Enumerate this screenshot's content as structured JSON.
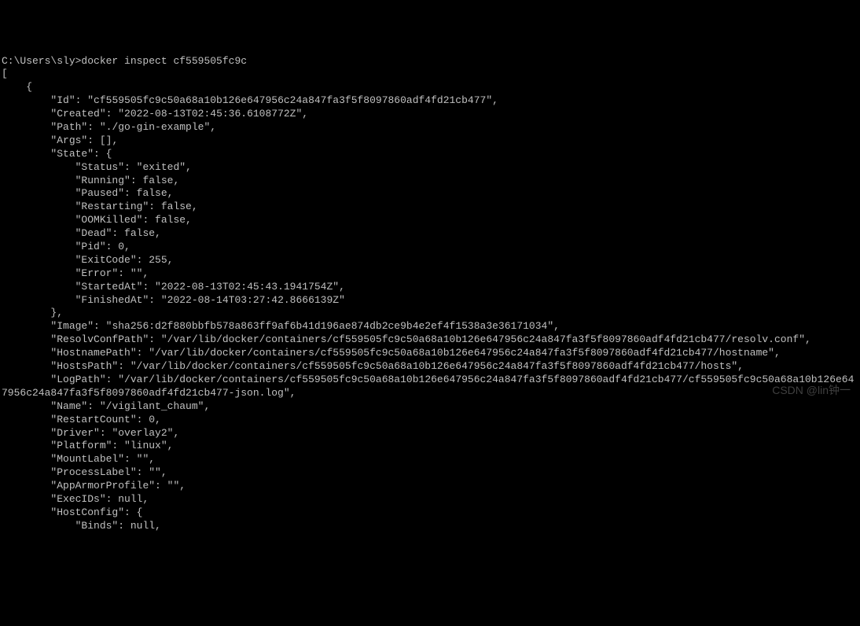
{
  "prompt": "C:\\Users\\sly>",
  "command": "docker inspect cf559505fc9c",
  "json_start": "[\n    {",
  "fields": {
    "id_key": "        \"Id\": ",
    "id_val": "\"cf559505fc9c50a68a10b126e647956c24a847fa3f5f8097860adf4fd21cb477\",",
    "created_key": "        \"Created\": ",
    "created_val": "\"2022-08-13T02:45:36.6108772Z\",",
    "path_key": "        \"Path\": ",
    "path_val": "\"./go-gin-example\",",
    "args_key": "        \"Args\": ",
    "args_val": "[],",
    "state_key": "        \"State\": {",
    "status_key": "            \"Status\": ",
    "status_val": "\"exited\",",
    "running_key": "            \"Running\": ",
    "running_val": "false,",
    "paused_key": "            \"Paused\": ",
    "paused_val": "false,",
    "restarting_key": "            \"Restarting\": ",
    "restarting_val": "false,",
    "oomkilled_key": "            \"OOMKilled\": ",
    "oomkilled_val": "false,",
    "dead_key": "            \"Dead\": ",
    "dead_val": "false,",
    "pid_key": "            \"Pid\": ",
    "pid_val": "0,",
    "exitcode_key": "            \"ExitCode\": ",
    "exitcode_val": "255,",
    "error_key": "            \"Error\": ",
    "error_val": "\"\",",
    "startedat_key": "            \"StartedAt\": ",
    "startedat_val": "\"2022-08-13T02:45:43.1941754Z\",",
    "finishedat_key": "            \"FinishedAt\": ",
    "finishedat_val": "\"2022-08-14T03:27:42.8666139Z\"",
    "state_close": "        },",
    "image_key": "        \"Image\": ",
    "image_val": "\"sha256:d2f880bbfb578a863ff9af6b41d196ae874db2ce9b4e2ef4f1538a3e36171034\",",
    "resolvconfpath_key": "        \"ResolvConfPath\": ",
    "resolvconfpath_val": "\"/var/lib/docker/containers/cf559505fc9c50a68a10b126e647956c24a847fa3f5f8097860adf4fd21cb477/resolv.conf\",",
    "hostnamepath_key": "        \"HostnamePath\": ",
    "hostnamepath_val": "\"/var/lib/docker/containers/cf559505fc9c50a68a10b126e647956c24a847fa3f5f8097860adf4fd21cb477/hostname\",",
    "hostspath_key": "        \"HostsPath\": ",
    "hostspath_val": "\"/var/lib/docker/containers/cf559505fc9c50a68a10b126e647956c24a847fa3f5f8097860adf4fd21cb477/hosts\",",
    "logpath_key": "        \"LogPath\": ",
    "logpath_val": "\"/var/lib/docker/containers/cf559505fc9c50a68a10b126e647956c24a847fa3f5f8097860adf4fd21cb477/cf559505fc9c50a68a10b126e647956c24a847fa3f5f8097860adf4fd21cb477-json.log\",",
    "name_key": "        \"Name\": ",
    "name_val": "\"/vigilant_chaum\",",
    "restartcount_key": "        \"RestartCount\": ",
    "restartcount_val": "0,",
    "driver_key": "        \"Driver\": ",
    "driver_val": "\"overlay2\",",
    "platform_key": "        \"Platform\": ",
    "platform_val": "\"linux\",",
    "mountlabel_key": "        \"MountLabel\": ",
    "mountlabel_val": "\"\",",
    "processlabel_key": "        \"ProcessLabel\": ",
    "processlabel_val": "\"\",",
    "apparmor_key": "        \"AppArmorProfile\": ",
    "apparmor_val": "\"\",",
    "execids_key": "        \"ExecIDs\": ",
    "execids_val": "null,",
    "hostconfig_key": "        \"HostConfig\": {",
    "binds_key": "            \"Binds\": ",
    "binds_val": "null,"
  },
  "watermark": "CSDN @lin钟一"
}
